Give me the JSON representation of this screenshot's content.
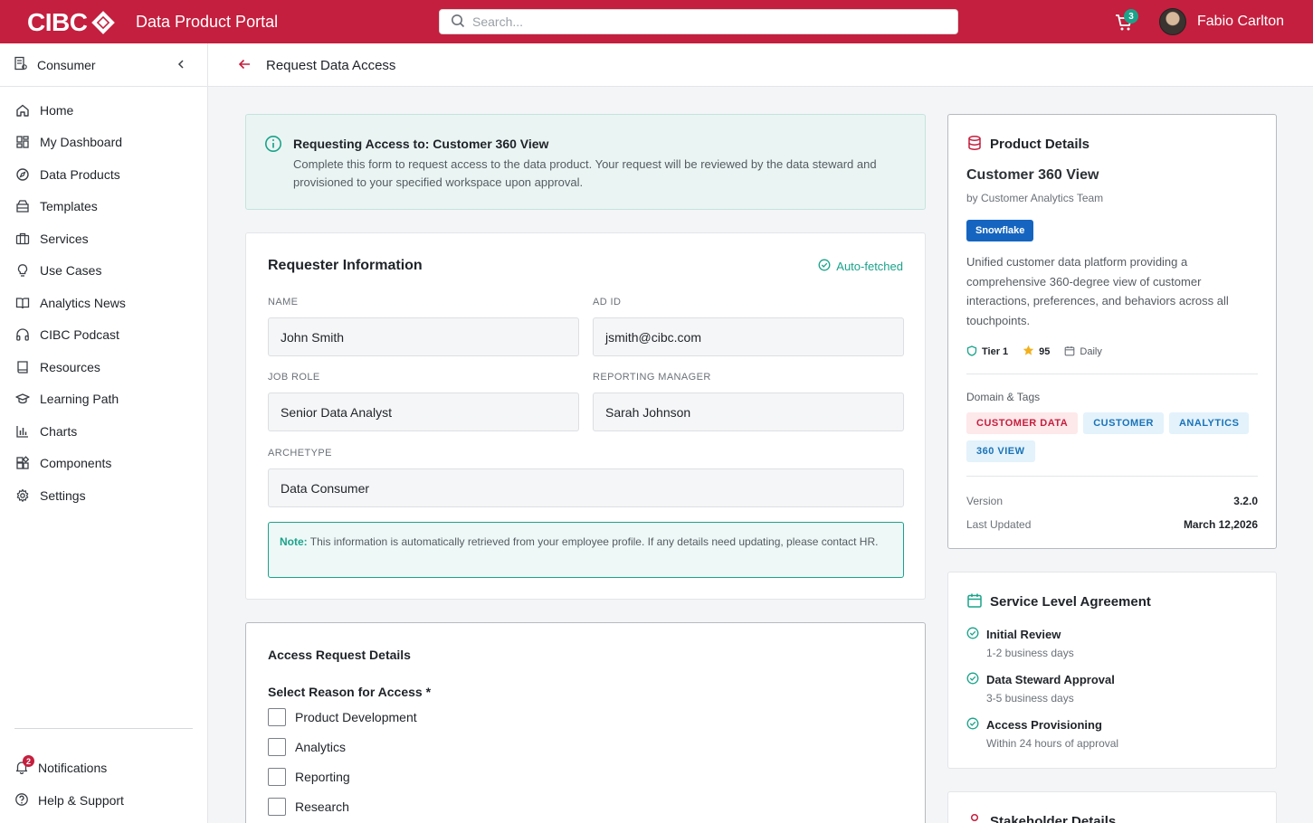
{
  "topbar": {
    "brand": "CIBC",
    "app_title": "Data Product Portal",
    "search_placeholder": "Search...",
    "cart_count": "3",
    "user_name": "Fabio Carlton"
  },
  "sidebar": {
    "section": "Consumer",
    "items": [
      {
        "label": "Home",
        "icon": "home-icon"
      },
      {
        "label": "My Dashboard",
        "icon": "dashboard-icon"
      },
      {
        "label": "Data Products",
        "icon": "compass-icon"
      },
      {
        "label": "Templates",
        "icon": "templates-icon"
      },
      {
        "label": "Services",
        "icon": "briefcase-icon"
      },
      {
        "label": "Use Cases",
        "icon": "lightbulb-icon"
      },
      {
        "label": "Analytics News",
        "icon": "book-open-icon"
      },
      {
        "label": "CIBC Podcast",
        "icon": "headphones-icon"
      },
      {
        "label": "Resources",
        "icon": "book-icon"
      },
      {
        "label": "Learning Path",
        "icon": "graduation-cap-icon"
      },
      {
        "label": "Charts",
        "icon": "bar-chart-icon"
      },
      {
        "label": "Components",
        "icon": "components-icon"
      },
      {
        "label": "Settings",
        "icon": "gear-icon"
      }
    ],
    "notifications": {
      "label": "Notifications",
      "count": "2"
    },
    "help": {
      "label": "Help & Support"
    }
  },
  "page": {
    "title": "Request Data Access"
  },
  "banner": {
    "title": "Requesting Access to: Customer 360 View",
    "description": "Complete this form to request access to the data product. Your request will be reviewed by the data steward and provisioned to your specified workspace upon approval."
  },
  "requester": {
    "title": "Requester Information",
    "auto_fetched": "Auto-fetched",
    "fields": {
      "name_label": "NAME",
      "name_value": "John Smith",
      "adid_label": "AD ID",
      "adid_value": "jsmith@cibc.com",
      "role_label": "JOB ROLE",
      "role_value": "Senior Data Analyst",
      "manager_label": "REPORTING MANAGER",
      "manager_value": "Sarah Johnson",
      "archetype_label": "ARCHETYPE",
      "archetype_value": "Data Consumer"
    },
    "note_label": "Note:",
    "note_text": "This information is automatically retrieved from your employee profile. If any details need updating, please contact HR."
  },
  "access": {
    "title": "Access Request Details",
    "reason_label": "Select Reason for Access *",
    "options": [
      "Product Development",
      "Analytics",
      "Reporting",
      "Research"
    ]
  },
  "product": {
    "header": "Product Details",
    "name": "Customer 360 View",
    "team": "by Customer Analytics Team",
    "platform": "Snowflake",
    "description": "Unified customer data platform providing a comprehensive 360-degree view of customer interactions, preferences, and behaviors across all touchpoints.",
    "tier": "Tier 1",
    "rating": "95",
    "frequency": "Daily",
    "tags_label": "Domain & Tags",
    "tags": [
      {
        "label": "CUSTOMER DATA",
        "style": "red"
      },
      {
        "label": "CUSTOMER",
        "style": "blue"
      },
      {
        "label": "ANALYTICS",
        "style": "blue"
      },
      {
        "label": "360 VIEW",
        "style": "blue"
      }
    ],
    "version_label": "Version",
    "version": "3.2.0",
    "updated_label": "Last Updated",
    "updated": "March 12,2026"
  },
  "sla": {
    "header": "Service Level Agreement",
    "items": [
      {
        "title": "Initial Review",
        "detail": "1-2 business days"
      },
      {
        "title": "Data Steward Approval",
        "detail": "3-5 business days"
      },
      {
        "title": "Access Provisioning",
        "detail": "Within 24 hours of approval"
      }
    ]
  },
  "stakeholder": {
    "header": "Stakeholder Details"
  },
  "colors": {
    "brand": "#c41f3e",
    "accent": "#1aa38a",
    "platform": "#1565c0"
  }
}
